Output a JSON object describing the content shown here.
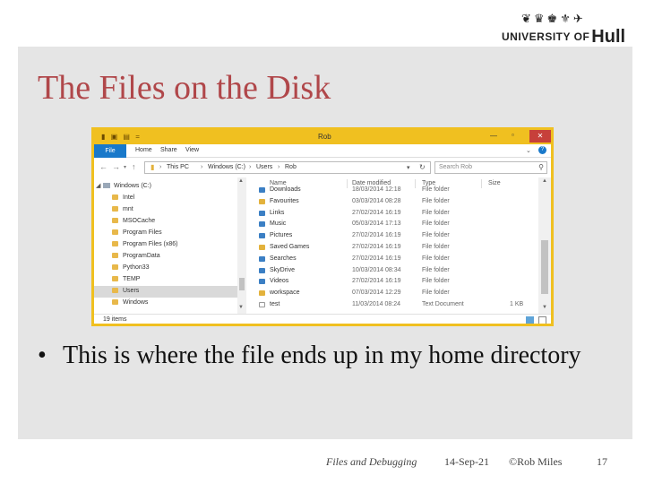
{
  "logo": {
    "text_university": "UNIVERSITY OF",
    "text_hull": "Hull",
    "crest": "❦♛♚⚜✈"
  },
  "slide": {
    "title": "The Files on the Disk",
    "bullet_symbol": "•",
    "bullet": "This is where the file ends up in my home directory"
  },
  "explorer": {
    "window_title": "Rob",
    "quick_access_icons": "▮ ▣ ▤ =",
    "ribbon_tabs": [
      "File",
      "Home",
      "Share",
      "View"
    ],
    "address_crumbs": [
      "This PC",
      "Windows (C:)",
      "Users",
      "Rob"
    ],
    "search_placeholder": "Search Rob",
    "columns": [
      "Name",
      "Date modified",
      "Type",
      "Size"
    ],
    "nav_tree": [
      {
        "label": "Windows (C:)",
        "level": 0,
        "type": "drive"
      },
      {
        "label": "Intel",
        "level": 1,
        "type": "folder"
      },
      {
        "label": "mnt",
        "level": 1,
        "type": "folder"
      },
      {
        "label": "MSOCache",
        "level": 1,
        "type": "folder"
      },
      {
        "label": "Program Files",
        "level": 1,
        "type": "folder"
      },
      {
        "label": "Program Files (x86)",
        "level": 1,
        "type": "folder"
      },
      {
        "label": "ProgramData",
        "level": 1,
        "type": "folder"
      },
      {
        "label": "Python33",
        "level": 1,
        "type": "folder"
      },
      {
        "label": "TEMP",
        "level": 1,
        "type": "folder"
      },
      {
        "label": "Users",
        "level": 1,
        "type": "folder",
        "selected": true
      },
      {
        "label": "Windows",
        "level": 1,
        "type": "folder"
      }
    ],
    "files": [
      {
        "name": "Downloads",
        "date": "18/03/2014 12:18",
        "type": "File folder",
        "size": "",
        "icon_color": "#3b7fc4"
      },
      {
        "name": "Favourites",
        "date": "03/03/2014 08:28",
        "type": "File folder",
        "size": "",
        "icon_color": "#e3b23c"
      },
      {
        "name": "Links",
        "date": "27/02/2014 16:19",
        "type": "File folder",
        "size": "",
        "icon_color": "#3b7fc4"
      },
      {
        "name": "Music",
        "date": "05/03/2014 17:13",
        "type": "File folder",
        "size": "",
        "icon_color": "#3b7fc4"
      },
      {
        "name": "Pictures",
        "date": "27/02/2014 16:19",
        "type": "File folder",
        "size": "",
        "icon_color": "#3b7fc4"
      },
      {
        "name": "Saved Games",
        "date": "27/02/2014 16:19",
        "type": "File folder",
        "size": "",
        "icon_color": "#e3b23c"
      },
      {
        "name": "Searches",
        "date": "27/02/2014 16:19",
        "type": "File folder",
        "size": "",
        "icon_color": "#3b7fc4"
      },
      {
        "name": "SkyDrive",
        "date": "10/03/2014 08:34",
        "type": "File folder",
        "size": "",
        "icon_color": "#3b7fc4"
      },
      {
        "name": "Videos",
        "date": "27/02/2014 16:19",
        "type": "File folder",
        "size": "",
        "icon_color": "#3b7fc4"
      },
      {
        "name": "workspace",
        "date": "07/03/2014 12:29",
        "type": "File folder",
        "size": "",
        "icon_color": "#e3b23c"
      },
      {
        "name": "test",
        "date": "11/03/2014 08:24",
        "type": "Text Document",
        "size": "1 KB",
        "icon_color": "#ffffff"
      }
    ],
    "status_count": "19 items"
  },
  "footer": {
    "title": "Files and Debugging",
    "date": "14-Sep-21",
    "author": "©Rob Miles",
    "page": "17"
  },
  "colors": {
    "title_red": "#b0474a",
    "explorer_accent": "#f0c020",
    "file_tab_blue": "#1979ca",
    "close_red": "#c7403a",
    "panel_gray": "#e5e5e5"
  }
}
